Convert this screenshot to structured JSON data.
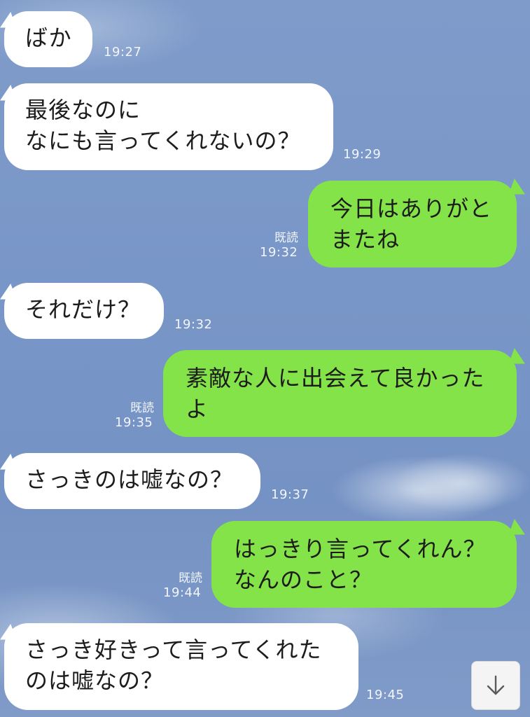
{
  "messages": [
    {
      "dir": "in",
      "lines": [
        "ばか"
      ],
      "time": "19:27"
    },
    {
      "dir": "in",
      "lines": [
        "最後なのに",
        "なにも言ってくれないの？"
      ],
      "time": "19:29"
    },
    {
      "dir": "out",
      "lines": [
        "今日はありがと",
        "またね"
      ],
      "read": "既読",
      "time": "19:32"
    },
    {
      "dir": "in",
      "lines": [
        "それだけ？"
      ],
      "time": "19:32"
    },
    {
      "dir": "out",
      "lines": [
        "素敵な人に出会えて良かった",
        "よ"
      ],
      "read": "既読",
      "time": "19:35"
    },
    {
      "dir": "in",
      "lines": [
        "さっきのは嘘なの？"
      ],
      "time": "19:37"
    },
    {
      "dir": "out",
      "lines": [
        "はっきり言ってくれん？",
        "なんのこと？"
      ],
      "read": "既読",
      "time": "19:44"
    },
    {
      "dir": "in",
      "lines": [
        "さっき好きって言ってくれた",
        "のは嘘なの？"
      ],
      "time": "19:45"
    }
  ],
  "scroll_button": {
    "icon": "arrow-down-icon"
  },
  "colors": {
    "incoming_bubble": "#ffffff",
    "outgoing_bubble": "#85e34a",
    "background": "#7896c7"
  }
}
